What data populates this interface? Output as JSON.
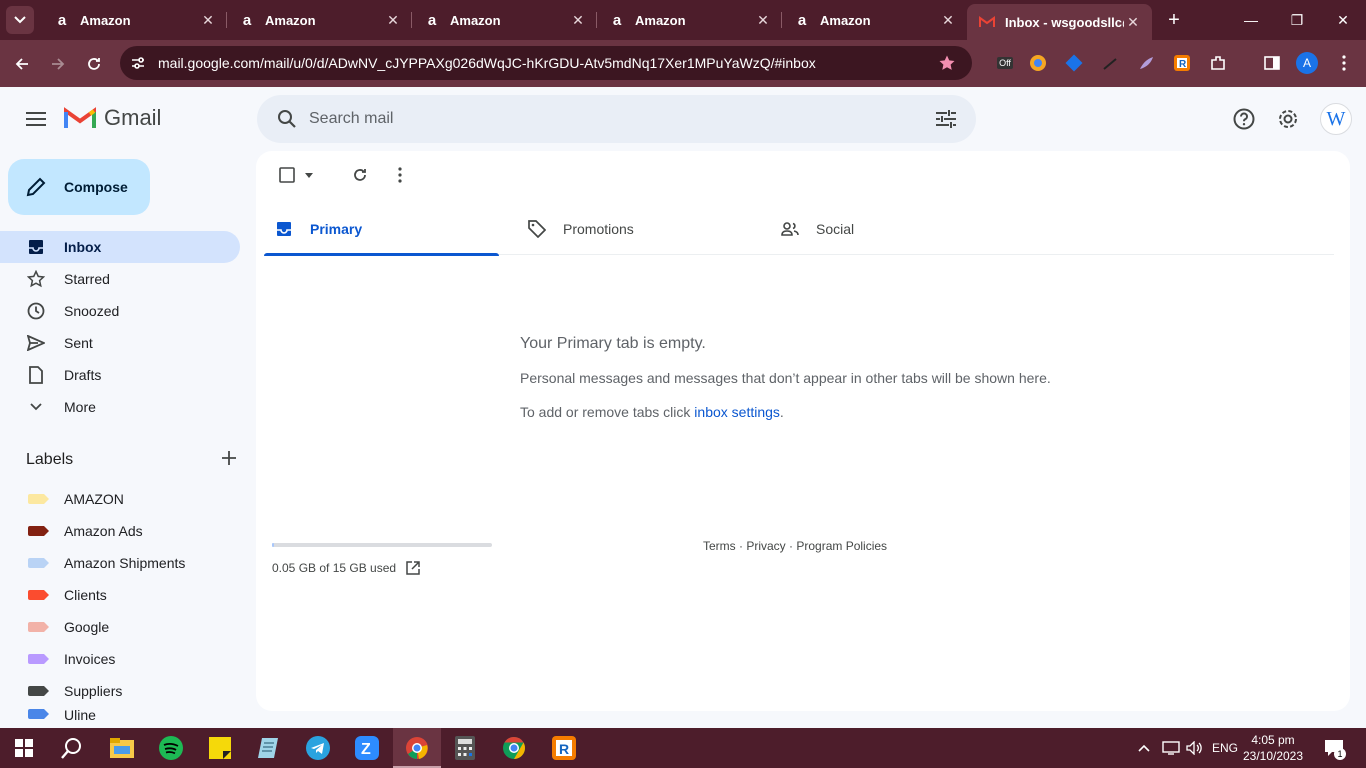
{
  "browser": {
    "tabs": [
      {
        "title": "Amazon",
        "favicon": "amazon-icon"
      },
      {
        "title": "Amazon",
        "favicon": "amazon-icon"
      },
      {
        "title": "Amazon",
        "favicon": "amazon-icon"
      },
      {
        "title": "Amazon",
        "favicon": "amazon-icon"
      },
      {
        "title": "Amazon",
        "favicon": "amazon-icon"
      },
      {
        "title": "Inbox - wsgoodsllc@",
        "favicon": "gmail-icon",
        "active": true
      }
    ],
    "url": "mail.google.com/mail/u/0/d/ADwNV_cJYPPAXg026dWqJC-hKrGDU-Atv5mdNq17Xer1MPuYaWzQ/#inbox",
    "profile_initial": "A",
    "ext_badge": "Off",
    "theme_color": "#6a3442"
  },
  "gmail": {
    "logo_text": "Gmail",
    "search_placeholder": "Search mail",
    "avatar_initial": "W",
    "compose_label": "Compose",
    "nav": [
      {
        "label": "Inbox",
        "icon": "inbox-icon",
        "active": true
      },
      {
        "label": "Starred",
        "icon": "star-icon"
      },
      {
        "label": "Snoozed",
        "icon": "clock-icon"
      },
      {
        "label": "Sent",
        "icon": "send-icon"
      },
      {
        "label": "Drafts",
        "icon": "draft-icon"
      },
      {
        "label": "More",
        "icon": "chevron-down-icon"
      }
    ],
    "labels_title": "Labels",
    "labels": [
      {
        "name": "AMAZON",
        "color": "#fce8a0"
      },
      {
        "name": "Amazon Ads",
        "color": "#822111"
      },
      {
        "name": "Amazon Shipments",
        "color": "#b9d3f5"
      },
      {
        "name": "Clients",
        "color": "#fb4c2f"
      },
      {
        "name": "Google",
        "color": "#f2b2a8"
      },
      {
        "name": "Invoices",
        "color": "#b99aff"
      },
      {
        "name": "Suppliers",
        "color": "#444746"
      },
      {
        "name": "Uline",
        "color": "#4a86e8"
      }
    ],
    "tabs": [
      {
        "label": "Primary",
        "icon": "inbox-icon",
        "active": true
      },
      {
        "label": "Promotions",
        "icon": "tag-icon"
      },
      {
        "label": "Social",
        "icon": "people-icon"
      }
    ],
    "empty": {
      "heading": "Your Primary tab is empty.",
      "line1": "Personal messages and messages that don’t appear in other tabs will be shown here.",
      "line2_prefix": "To add or remove tabs click ",
      "line2_link": "inbox settings",
      "line2_suffix": "."
    },
    "storage": {
      "text": "0.05 GB of 15 GB used",
      "used_fraction": 0.0033
    },
    "footer": {
      "terms": "Terms",
      "privacy": "Privacy",
      "policies": "Program Policies",
      "sep": " · "
    }
  },
  "taskbar": {
    "lang": "ENG",
    "time": "4:05 pm",
    "date": "23/10/2023",
    "notification_count": "1"
  }
}
